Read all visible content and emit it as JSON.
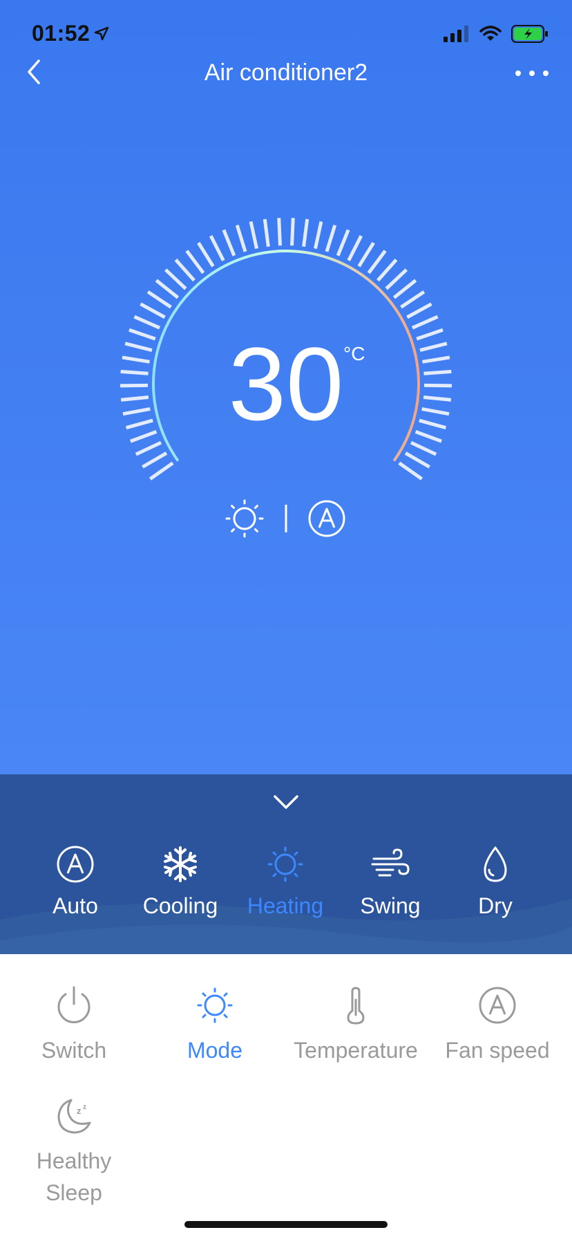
{
  "status": {
    "time": "01:52"
  },
  "nav": {
    "title": "Air conditioner2"
  },
  "thermostat": {
    "temperature": "30",
    "unit": "°C"
  },
  "mode_panel": {
    "modes": [
      {
        "label": "Auto",
        "icon": "auto-icon",
        "active": false
      },
      {
        "label": "Cooling",
        "icon": "snowflake-icon",
        "active": false
      },
      {
        "label": "Heating",
        "icon": "sun-icon",
        "active": true
      },
      {
        "label": "Swing",
        "icon": "wind-icon",
        "active": false
      },
      {
        "label": "Dry",
        "icon": "drop-icon",
        "active": false
      }
    ]
  },
  "controls": [
    {
      "label": "Switch",
      "icon": "power-icon",
      "active": false
    },
    {
      "label": "Mode",
      "icon": "sun-icon",
      "active": true
    },
    {
      "label": "Temperature",
      "icon": "thermometer-icon",
      "active": false
    },
    {
      "label": "Fan speed",
      "icon": "auto-icon",
      "active": false
    },
    {
      "label": "Healthy Sleep",
      "icon": "moon-icon",
      "active": false
    }
  ],
  "colors": {
    "accent": "#3d88ff",
    "hero": "#3a78ef",
    "panel": "#2c549c",
    "inactive": "#9a9a9a"
  }
}
